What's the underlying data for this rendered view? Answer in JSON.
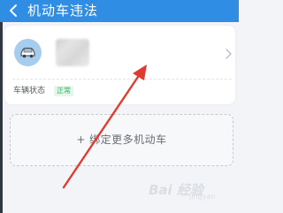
{
  "header": {
    "title": "机动车违法",
    "back_icon": "chevron-left-icon",
    "background_color": "#2f8de4"
  },
  "vehicle_card": {
    "avatar_icon": "car-icon",
    "plate_number_visible": false,
    "status_label": "车辆状态",
    "status_value": "正常",
    "status_color": "#2fb45a",
    "chevron_icon": "chevron-right-icon"
  },
  "bind_more": {
    "label": "+ 绑定更多机动车"
  },
  "overlay": {
    "annotation": "red-arrow-pointing-to-card",
    "arrow_color": "#e23a2e"
  },
  "watermark": {
    "brand": "Bai 经验",
    "sub": "jingyan"
  }
}
